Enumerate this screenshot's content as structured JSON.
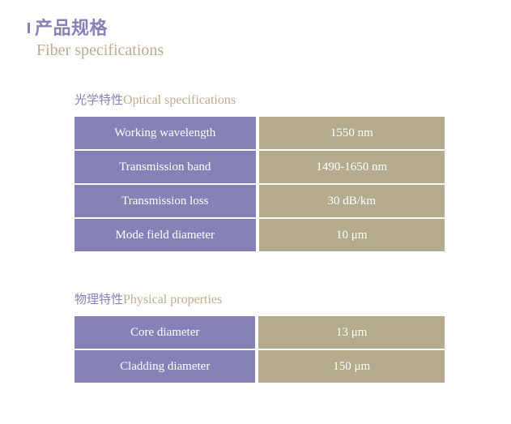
{
  "header": {
    "title_cn": "产品规格",
    "title_en": "Fiber specifications"
  },
  "sections": [
    {
      "heading_cn": "光学特性",
      "heading_en": "Optical specifications",
      "rows": [
        {
          "label": "Working wavelength",
          "value": "1550 nm"
        },
        {
          "label": "Transmission band",
          "value": "1490-1650 nm"
        },
        {
          "label": "Transmission loss",
          "value": "30 dB/km"
        },
        {
          "label": "Mode field diameter",
          "value": "10 μm"
        }
      ]
    },
    {
      "heading_cn": "物理特性",
      "heading_en": "Physical properties",
      "rows": [
        {
          "label": "Core diameter",
          "value": "13 μm"
        },
        {
          "label": "Cladding diameter",
          "value": "150 μm"
        }
      ]
    }
  ],
  "colors": {
    "accent_purple": "#8582b8",
    "accent_tan": "#b3ab8c",
    "subtitle_tan": "#b7ae8d",
    "page_background": "#ffffff",
    "cell_text": "#ffffff"
  }
}
